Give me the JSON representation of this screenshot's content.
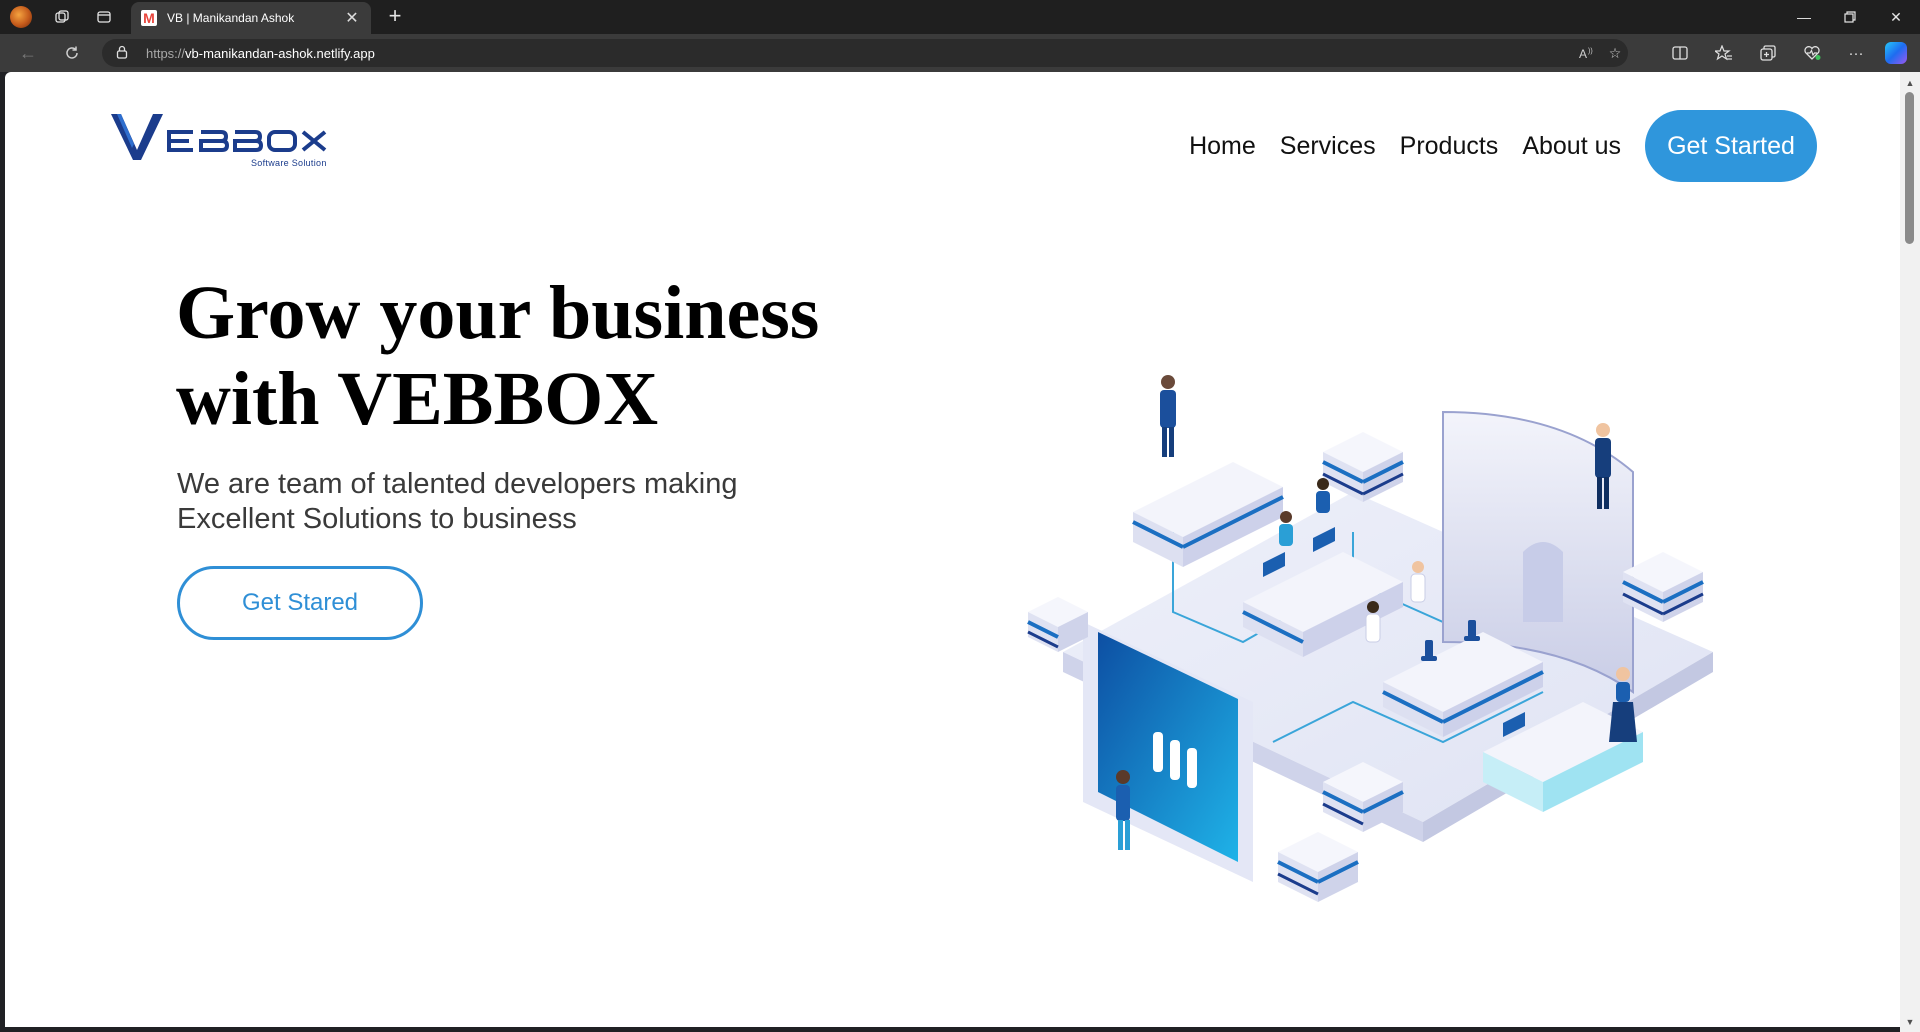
{
  "browser": {
    "tab_title": "VB | Manikandan Ashok",
    "tab_favicon_letter": "M",
    "url_scheme": "https://",
    "url_host": "vb-manikandan-ashok.netlify.app"
  },
  "site": {
    "logo_text": "VEBBOX",
    "logo_tagline": "Software Solution",
    "nav": {
      "home": "Home",
      "services": "Services",
      "products": "Products",
      "about": "About us",
      "cta": "Get Started"
    },
    "hero": {
      "title_line1": "Grow your business",
      "title_line2": "with VEBBOX",
      "subtitle_line1": "We are team of talented developers making",
      "subtitle_line2": "Excellent Solutions to business",
      "button": "Get Stared"
    }
  },
  "colors": {
    "brand_blue": "#2f96dc",
    "logo_navy": "#1b3c8c",
    "chrome_dark": "#1f1f1f",
    "chrome_toolbar": "#3b3b3b"
  },
  "icons": {
    "back": "back-arrow-icon",
    "refresh": "refresh-icon",
    "lock": "lock-icon",
    "read_aloud": "read-aloud-icon",
    "favorite": "star-icon",
    "split": "split-screen-icon",
    "favorites": "favorites-icon",
    "collections": "collections-icon",
    "browser_essentials": "heart-pulse-icon",
    "more": "more-icon",
    "copilot": "copilot-icon"
  }
}
